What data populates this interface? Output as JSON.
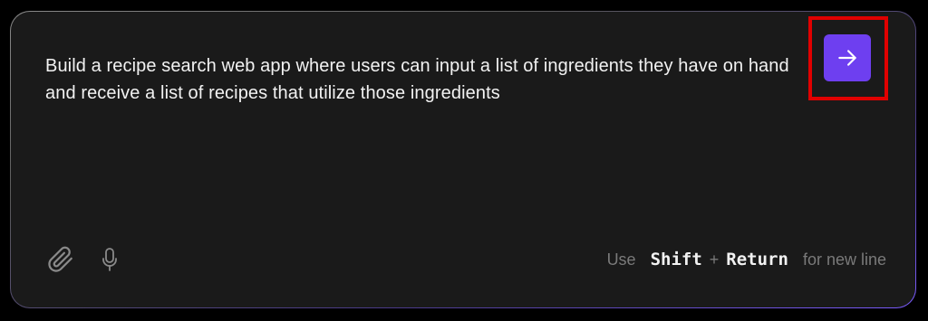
{
  "prompt": {
    "text": "Build a recipe search web app where users can input a list of ingredients they have on hand and receive a list of recipes that utilize those ingredients"
  },
  "send_button": {
    "icon": "arrow-right-icon",
    "color": "#6e3ff0",
    "highlight_color": "#e00000"
  },
  "toolbar": {
    "attach_icon": "paperclip-icon",
    "mic_icon": "microphone-icon"
  },
  "hint": {
    "use": "Use",
    "key1": "Shift",
    "plus": "+",
    "key2": "Return",
    "suffix": "for new line"
  }
}
